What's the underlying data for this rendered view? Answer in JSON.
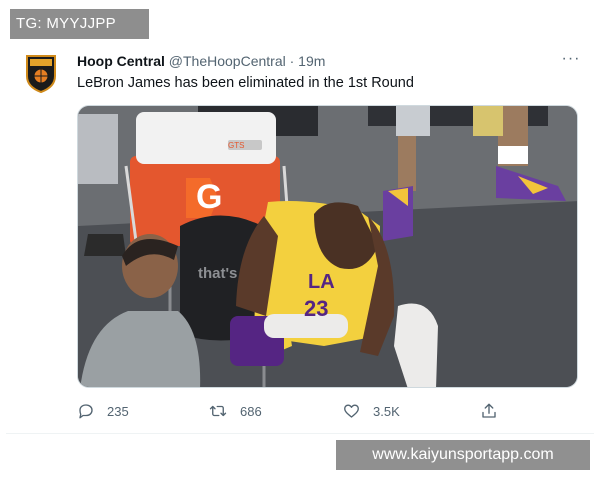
{
  "watermarks": {
    "top": "TG: MYYJJPP",
    "bottom": "www.kaiyunsportapp.com"
  },
  "tweet": {
    "author_name": "Hoop Central",
    "handle": "@TheHoopCentral",
    "separator": "·",
    "time": "19m",
    "more_label": "···",
    "text": "LeBron James has been eliminated in the 1st Round",
    "media": {
      "cooler_label": "G",
      "cooler_brand": "GTS",
      "chair_text": "that's g",
      "jersey_text": "LA",
      "jersey_number": "23",
      "player_colors": {
        "gold": "#f3d03e",
        "purple": "#552583"
      }
    },
    "actions": {
      "replies": "235",
      "retweets": "686",
      "likes": "3.5K"
    }
  }
}
